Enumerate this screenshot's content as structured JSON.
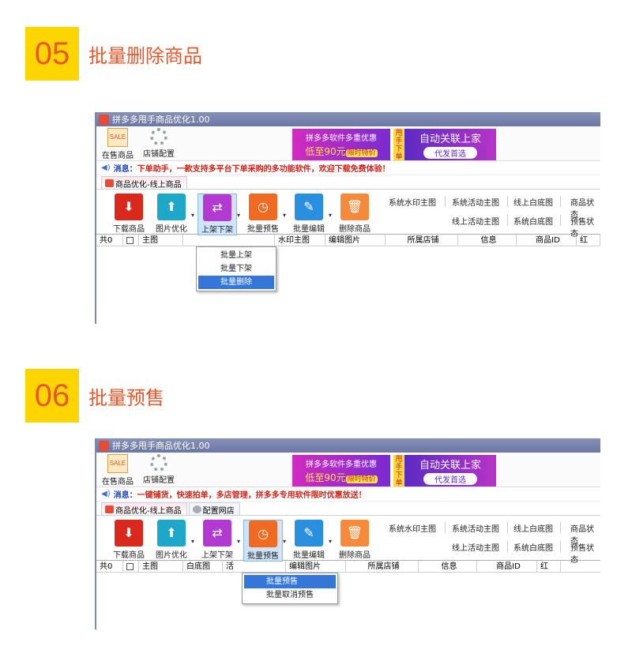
{
  "sections": [
    {
      "number": "05",
      "title": "批量删除商品",
      "window": {
        "title": "拼多多甩手商品优化1.00",
        "top_buttons": [
          "在售商品",
          "店铺配置"
        ],
        "banner": {
          "line1": "拼多多软件多重优惠",
          "line2": "低至90元",
          "tag": "限时特价",
          "mid": "甩手下单",
          "right_title": "自动关联上家",
          "right_pill": "代发首选"
        },
        "message_label": "消息：",
        "message_text": "下单助手，一款支持多平台下单采购的多功能软件，欢迎下载免费体验！",
        "tabs": [
          "商品优化-线上商品"
        ],
        "tools": [
          "下载商品",
          "图片优化",
          "上架下架",
          "批量预售",
          "批量编辑",
          "删除商品"
        ],
        "right_links": [
          [
            "系统水印主图",
            "系统活动主图",
            "线上白底图",
            "商品状态"
          ],
          [
            "线上活动主图",
            "系统白底图",
            "预售状态"
          ]
        ],
        "columns": [
          "共0",
          "",
          "主图",
          "",
          "水印主图",
          "编辑图片",
          "所属店铺",
          "信息",
          "商品ID",
          "红"
        ],
        "dropdown": [
          "批量上架",
          "批量下架",
          "批量删除"
        ],
        "highlighted": 2
      }
    },
    {
      "number": "06",
      "title": "批量预售",
      "window": {
        "title": "拼多多甩手商品优化1.00",
        "top_buttons": [
          "在售商品",
          "店铺配置"
        ],
        "banner": {
          "line1": "拼多多软件多重优惠",
          "line2": "低至90元",
          "tag": "限时特价",
          "mid": "甩手下单",
          "right_title": "自动关联上家",
          "right_pill": "代发首选"
        },
        "message_label": "消息：",
        "message_text": "一键铺货，快速拍单，多店管理，拼多多专用软件限时优惠放送！",
        "tabs": [
          "商品优化-线上商品",
          "配置网店"
        ],
        "tools": [
          "下载商品",
          "图片优化",
          "上架下架",
          "批量预售",
          "批量编辑",
          "删除商品"
        ],
        "right_links": [
          [
            "系统水印主图",
            "系统活动主图",
            "线上白底图",
            "商品状态"
          ],
          [
            "线上活动主图",
            "系统白底图",
            "预售状态"
          ]
        ],
        "columns": [
          "共0",
          "",
          "主图",
          "白底图",
          "活",
          "编辑图片",
          "所属店铺",
          "信息",
          "商品ID",
          "红"
        ],
        "dropdown": [
          "批量预售",
          "批量取消预售"
        ],
        "highlighted": 0
      }
    }
  ],
  "colors": {
    "accent": "#e8572a",
    "badge": "#ffd500",
    "highlight": "#3477d9"
  }
}
